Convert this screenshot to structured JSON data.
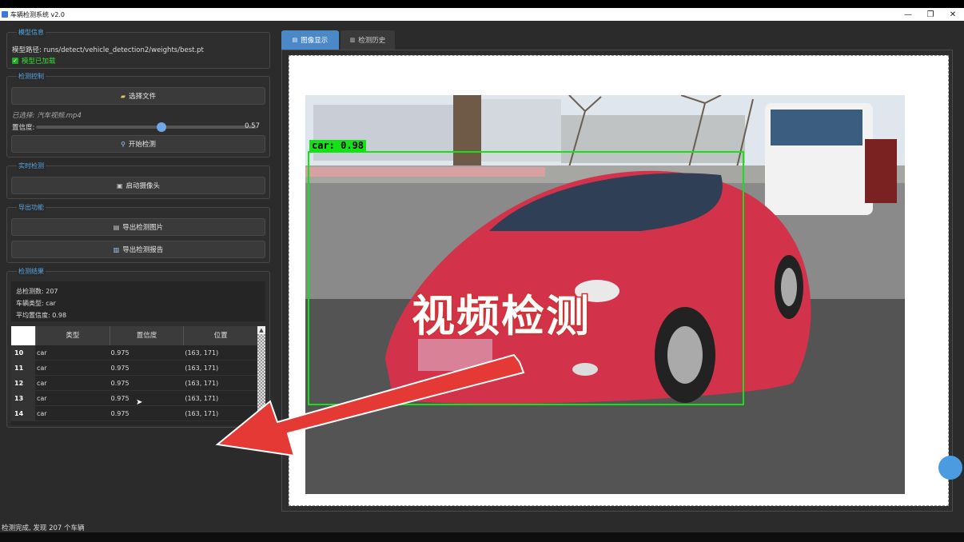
{
  "window": {
    "title": "车辆检测系统 v2.0",
    "controls": [
      "—",
      "❐",
      "✕"
    ]
  },
  "model_info": {
    "title": "模型信息",
    "path_label": "模型路径: runs/detect/vehicle_detection2/weights/best.pt",
    "loaded_label": "模型已加载"
  },
  "detection_control": {
    "title": "检测控制",
    "select_file_label": "选择文件",
    "selected_text": "已选择: 汽车视频.mp4",
    "confidence_label": "置信度:",
    "confidence_value": "0.57",
    "confidence_fraction": 0.57,
    "start_label": "开始检测"
  },
  "realtime": {
    "title": "实时检测",
    "camera_label": "启动摄像头"
  },
  "export": {
    "title": "导出功能",
    "export_image_label": "导出检测图片",
    "export_report_label": "导出检测报告"
  },
  "results": {
    "title": "检测结果",
    "total": "总检测数: 207",
    "vehicle_type": "车辆类型: car",
    "avg_conf": "平均置信度: 0.98",
    "columns": [
      "类型",
      "置信度",
      "位置"
    ],
    "rows": [
      {
        "n": "10",
        "type": "car",
        "conf": "0.975",
        "pos": "(163, 171)"
      },
      {
        "n": "11",
        "type": "car",
        "conf": "0.975",
        "pos": "(163, 171)"
      },
      {
        "n": "12",
        "type": "car",
        "conf": "0.975",
        "pos": "(163, 171)"
      },
      {
        "n": "13",
        "type": "car",
        "conf": "0.975",
        "pos": "(163, 171)"
      },
      {
        "n": "14",
        "type": "car",
        "conf": "0.975",
        "pos": "(163, 171)"
      }
    ]
  },
  "tabs": [
    {
      "label": "图像显示",
      "icon": "image-icon"
    },
    {
      "label": "检测历史",
      "icon": "history-icon"
    }
  ],
  "detection_label": "car: 0.98",
  "overlay_caption": "视频检测",
  "status": "检测完成, 发现 207 个车辆",
  "colors": {
    "accent": "#4b88c7",
    "box": "#16e016",
    "arrow": "#e53935"
  }
}
